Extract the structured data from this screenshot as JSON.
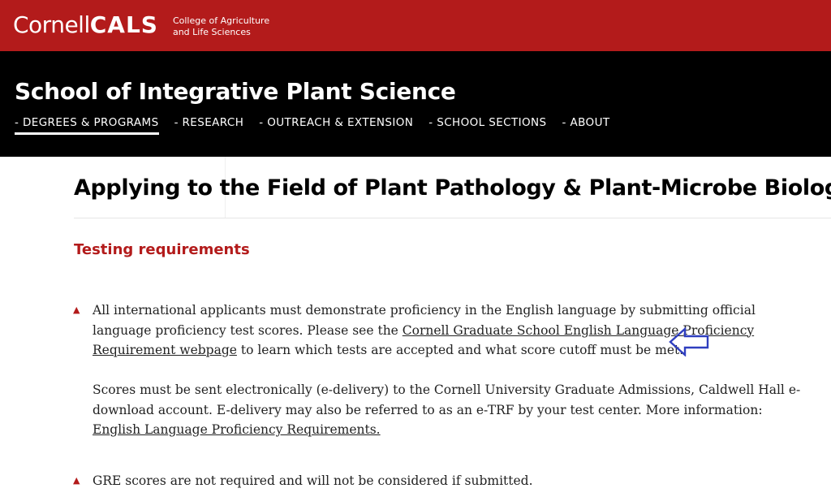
{
  "header": {
    "logo_cornell": "Cornell",
    "logo_cals": "CALS",
    "logo_sub_line1": "College of Agriculture",
    "logo_sub_line2": "and Life Sciences"
  },
  "site": {
    "title": "School of Integrative Plant Science"
  },
  "nav": {
    "items": [
      {
        "label": "- DEGREES & PROGRAMS"
      },
      {
        "label": "- RESEARCH"
      },
      {
        "label": "- OUTREACH & EXTENSION"
      },
      {
        "label": "- SCHOOL SECTIONS"
      },
      {
        "label": "- ABOUT"
      }
    ]
  },
  "main": {
    "page_title": "Applying to the Field of Plant Pathology & Plant-Microbe Biology",
    "section_heading": "Testing requirements",
    "bullet1": {
      "text_before": "All international applicants must demonstrate proficiency in the English language by submitting official language proficiency test scores. Please see the ",
      "link": "Cornell Graduate School English Language Proficiency Requirement webpage",
      "text_after": " to learn which tests are accepted and what score cutoff must be met."
    },
    "bullet1_followup": {
      "text_before": "Scores must be sent electronically (e-delivery) to the Cornell University Graduate Admissions, Caldwell Hall e-download account. E-delivery may also be referred to as an e-TRF by your test center. More information: ",
      "link": "English Language Proficiency Requirements."
    },
    "bullet2": {
      "text": "GRE scores are not required and will not be considered if submitted."
    }
  },
  "colors": {
    "brand_red": "#b31b1b",
    "black": "#000000",
    "arrow_blue": "#2f3fbf"
  }
}
